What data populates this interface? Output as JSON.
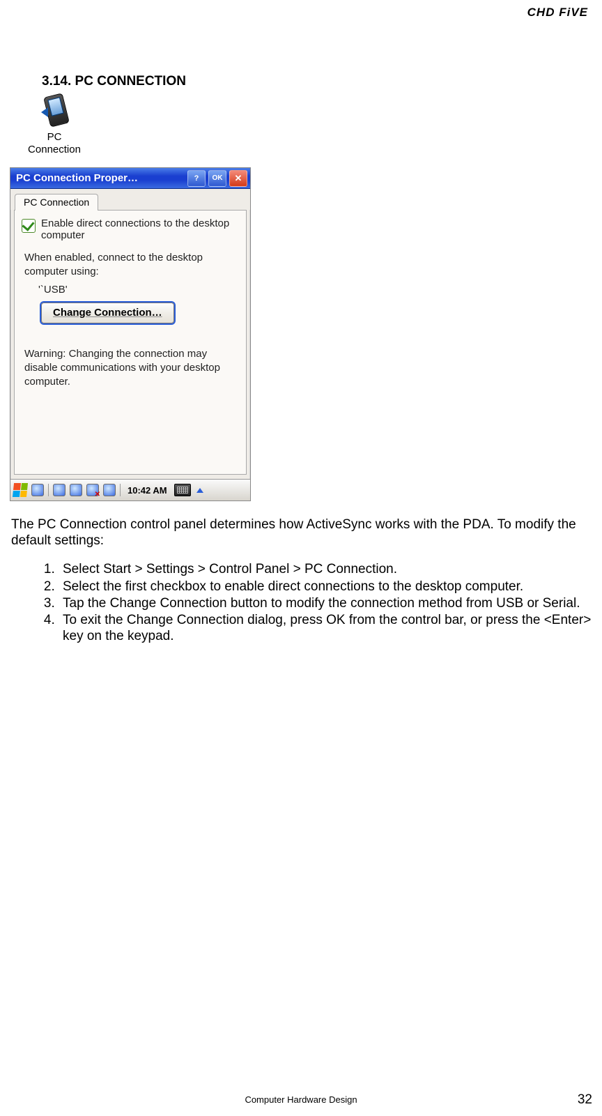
{
  "header": {
    "brand": "CHD FiVE"
  },
  "section": {
    "heading_prefix": "3.14. PC C",
    "heading_suffix": "ONNECTION"
  },
  "icon": {
    "label_line1": "PC",
    "label_line2": "Connection"
  },
  "window": {
    "title": "PC Connection Proper…",
    "help": "?",
    "ok": "OK",
    "close": "✕",
    "tab": "PC Connection",
    "chk_label": "Enable direct connections to the desktop computer",
    "when_text": "When enabled, connect to the desktop computer using:",
    "usb": "'`USB'",
    "change_btn": "Change Connection…",
    "warning": "Warning: Changing the connection may disable communications with your desktop computer."
  },
  "taskbar": {
    "clock": "10:42 AM"
  },
  "body": {
    "intro": "The PC Connection control panel determines how ActiveSync works with the PDA. To modify the default settings:",
    "steps": [
      "Select Start > Settings > Control Panel > PC Connection.",
      "Select the first checkbox to enable direct connections to the desktop computer.",
      "Tap the Change Connection button to modify the connection method from USB or Serial.",
      "To exit the Change Connection dialog, press OK from the control bar, or press the <Enter> key on the keypad."
    ]
  },
  "footer": {
    "text": "Computer Hardware Design",
    "page": "32"
  }
}
